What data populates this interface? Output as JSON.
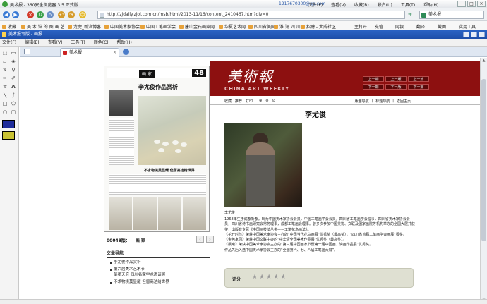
{
  "window": {
    "title": "美术报 - 360安全浏览器 3.5 正式版",
    "account": "1217670300@qq.com",
    "menu": [
      "文件(F)",
      "查看(V)",
      "收藏(B)",
      "帐户(U)",
      "工具(T)",
      "帮助(H)"
    ]
  },
  "address": {
    "url": "http://zjdaily.zjol.com.cn/msb/html/2013-11/16/content_2410467.htm?div=0",
    "search_value": "美术报"
  },
  "favorites": [
    "收藏",
    "美 术 馆 的 图 画 艺",
    "龙虎_新浪博客",
    "中国美术家协会",
    "中国工笔画学会",
    "唐山金石画家网",
    "华夏艺术网",
    "四川省美网",
    "淮 海 四 川",
    "招聘 - 大成社区",
    "主打开",
    "充值",
    "网银",
    "翻译",
    "截图",
    "实用工具"
  ],
  "app": {
    "title": "美术报专版 - 画报",
    "menu": [
      "文件(F)",
      "编辑(E)",
      "查看(V)",
      "工具(T)",
      "颜色(C)",
      "帮助(H)"
    ]
  },
  "tab": {
    "label": "美术报"
  },
  "paper": {
    "masthead_cn": "美術報",
    "masthead_en": "CHINA ART WEEKLY",
    "nav_buttons": [
      "上一期",
      "上一版",
      "上一篇",
      "下一期",
      "下一版",
      "下一篇"
    ],
    "tools_left": [
      "收藏",
      "推荐",
      "打印"
    ],
    "zoom": [
      "⊕",
      "⊖",
      "⊙"
    ],
    "tools_right": [
      "版面导航",
      "标题导航",
      "返回主页"
    ],
    "page_section": "画 家",
    "page_number": "48",
    "headline": "李尤俊作品赏析",
    "painting_caption": "不求物境莫显耀  但留高洁给世界",
    "issue_label": "00048版：",
    "issue_section": "画 家",
    "toc_header": "文章导航",
    "toc": [
      {
        "title": "李尤俊作品赏析",
        "sub": ""
      },
      {
        "title": "第六届美术艺术节",
        "sub": "笔墨天府 四川名家学术邀请展"
      },
      {
        "title": "不求物境莫显耀  但留高洁给世界",
        "sub": ""
      }
    ]
  },
  "article": {
    "title": "李尤俊",
    "caption": "李尤俊",
    "paragraphs": [
      "1968年生于成都新都。现为中国美术家协会会员，中国工笔画学会会员，四川省工笔画学会理事，四川省美术家协会会员，四川省诗书画研究会常务理事，成都工笔画会理事。曾多次参加中国美协、文联及国家画院等机构举办的全国大展并获奖，出版有专著《中国画技法丛书——工笔花鸟画法》。",
      "《花开时节》荣获中国美术家协会主办的“中国当代花鸟画展”优秀奖（最高奖），“四川省首届工笔画学会画展”银奖。",
      "《金色家园》荣获中国文联主办的“中华情全国美术作品展”优秀奖（最高奖）。",
      "《晨曦》荣获中国美术家协会主办的“第三届中国画家节暨第一届中国画、油画作品展”优秀奖。",
      "作品先后入选中国美术家协会主办的“全国第六、七、八届工笔画大展”。"
    ],
    "rating_label": "评分",
    "stars": 5
  }
}
